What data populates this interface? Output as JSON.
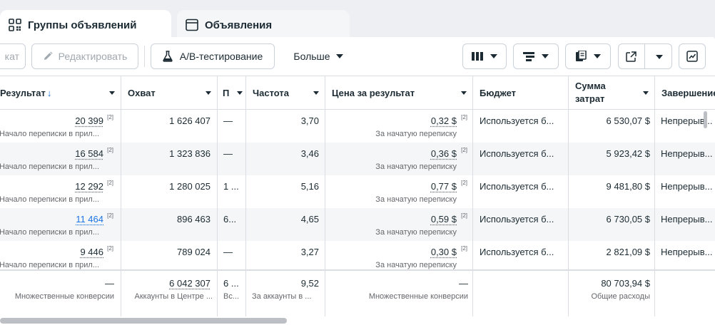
{
  "tabs": [
    {
      "label": "Группы объявлений",
      "icon": "grid-icon",
      "active": true
    },
    {
      "label": "Объявления",
      "icon": "ad-window-icon",
      "active": false
    }
  ],
  "toolbar": {
    "cut_label": "кат",
    "edit_label": "Редактировать",
    "ab_label": "A/B-тестирование",
    "more_label": "Больше"
  },
  "columns": {
    "result": "Результат",
    "reach": "Охват",
    "impressions": "П",
    "frequency": "Частота",
    "cost_per_result": "Цена за результат",
    "budget": "Бюджет",
    "spent_line1": "Сумма",
    "spent_line2": "затрат",
    "end": "Завершение"
  },
  "rows": [
    {
      "result": "20 399",
      "result_sub": "Начало переписки в прил...",
      "reach": "1 626 407",
      "impr": "—",
      "freq": "3,70",
      "cpr": "0,32 $",
      "cpr_sub": "За начатую переписку",
      "budget": "Используется б...",
      "spent": "6 530,07 $",
      "end": "Непрерыв..."
    },
    {
      "result": "16 584",
      "result_sub": "Начало переписки в прил...",
      "reach": "1 323 836",
      "impr": "—",
      "freq": "3,46",
      "cpr": "0,36 $",
      "cpr_sub": "За начатую переписку",
      "budget": "Используется б...",
      "spent": "5 923,42 $",
      "end": "Непрерыв..."
    },
    {
      "result": "12 292",
      "result_sub": "Начало переписки в прил...",
      "reach": "1 280 025",
      "impr": "1 ...",
      "freq": "5,16",
      "cpr": "0,77 $",
      "cpr_sub": "За начатую переписку",
      "budget": "Используется б...",
      "spent": "9 481,80 $",
      "end": "Непрерыв..."
    },
    {
      "result": "11 464",
      "result_sub": "Начало переписки в прил...",
      "reach": "896 463",
      "impr": "6...",
      "freq": "4,65",
      "cpr": "0,59 $",
      "cpr_sub": "За начатую переписку",
      "budget": "Используется б...",
      "spent": "6 730,05 $",
      "end": "Непрерыв..."
    },
    {
      "result": "9 446",
      "result_sub": "Начало переписки в прил...",
      "reach": "789 024",
      "impr": "—",
      "freq": "3,27",
      "cpr": "0,30 $",
      "cpr_sub": "За начатую переписку",
      "budget": "Используется б...",
      "spent": "2 821,09 $",
      "end": "Непрерыв..."
    }
  ],
  "footnote_mark": "[2]",
  "totals": {
    "result": "—",
    "result_sub": "Множественные конверсии",
    "reach": "6 042 307",
    "reach_sub": "Аккаунты в Центре ...",
    "impr": "6 ...",
    "impr_sub": "Вс...",
    "freq": "9,52",
    "freq_sub": "За аккаунты в ...",
    "cpr": "—",
    "cpr_sub": "Множественные конверсии",
    "spent": "80 703,94 $",
    "spent_sub": "Общие расходы"
  }
}
